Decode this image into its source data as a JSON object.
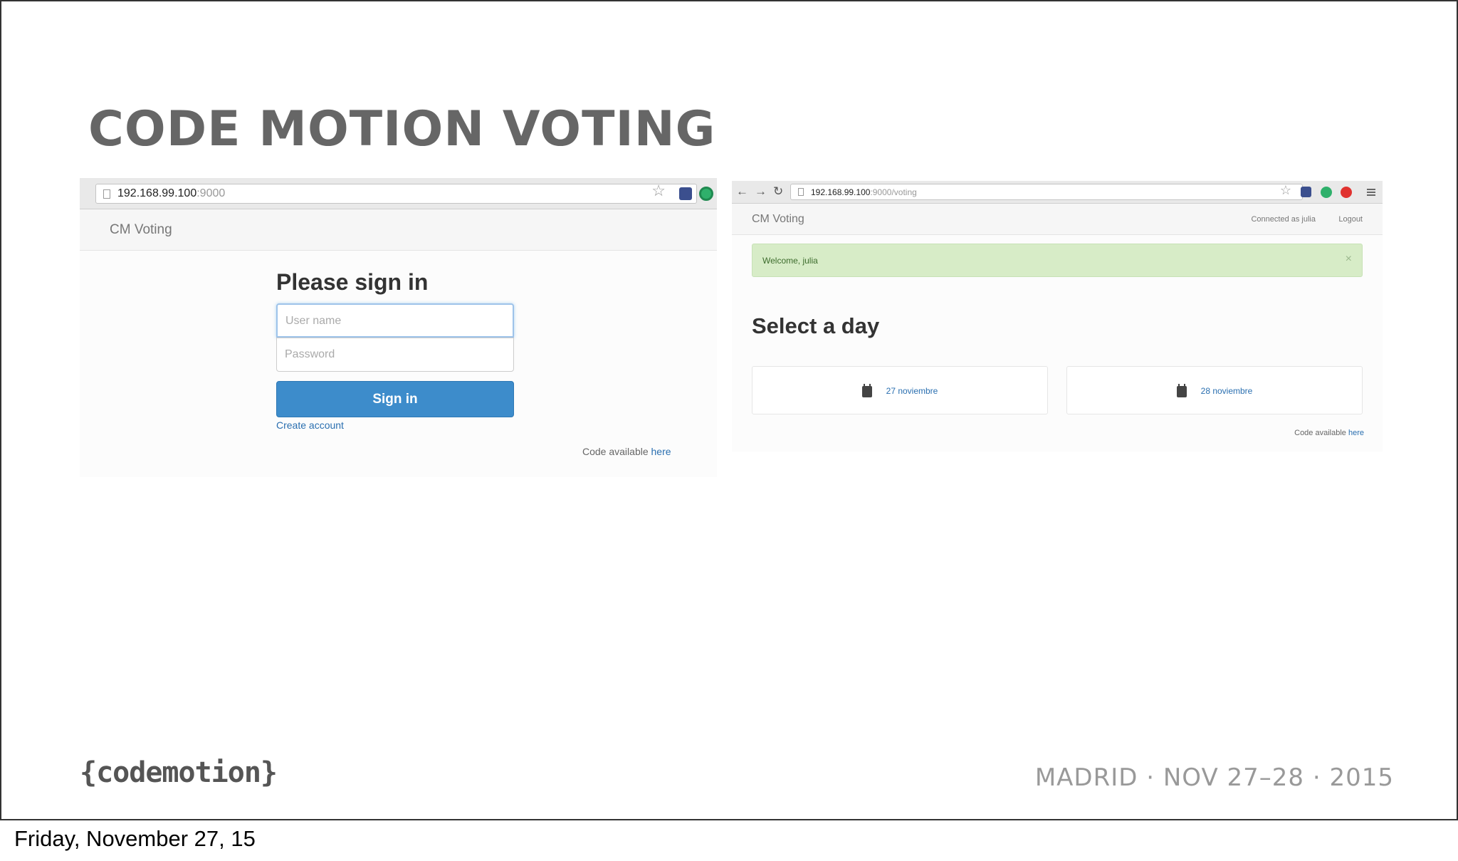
{
  "slide": {
    "title": "CODE MOTION VOTING",
    "logo_text": "{codemotion}",
    "event_info": "MADRID · NOV 27–28 · 2015"
  },
  "caption": "Friday, November 27, 15",
  "login_window": {
    "url_host": "192.168.99.100",
    "url_rest": ":9000",
    "brand": "CM Voting",
    "heading": "Please sign in",
    "username_placeholder": "User name",
    "password_placeholder": "Password",
    "signin_label": "Sign in",
    "create_account": "Create account",
    "code_available": "Code available ",
    "here": "here"
  },
  "voting_window": {
    "url_host": "192.168.99.100",
    "url_rest": ":9000/voting",
    "brand": "CM Voting",
    "connected": "Connected as julia",
    "logout": "Logout",
    "alert": "Welcome, julia",
    "alert_close": "×",
    "heading": "Select a day",
    "days": [
      {
        "label": "27 noviembre"
      },
      {
        "label": "28 noviembre"
      }
    ],
    "code_available": "Code available ",
    "here": "here"
  },
  "icons": {
    "star": "star-icon",
    "calendar": "calendar-icon",
    "back": "back-arrow-icon",
    "forward": "forward-arrow-icon",
    "reload": "reload-icon"
  },
  "colors": {
    "primary_button": "#3d8ccb",
    "link": "#2a6fb0",
    "alert_bg": "#d7ecc7"
  }
}
